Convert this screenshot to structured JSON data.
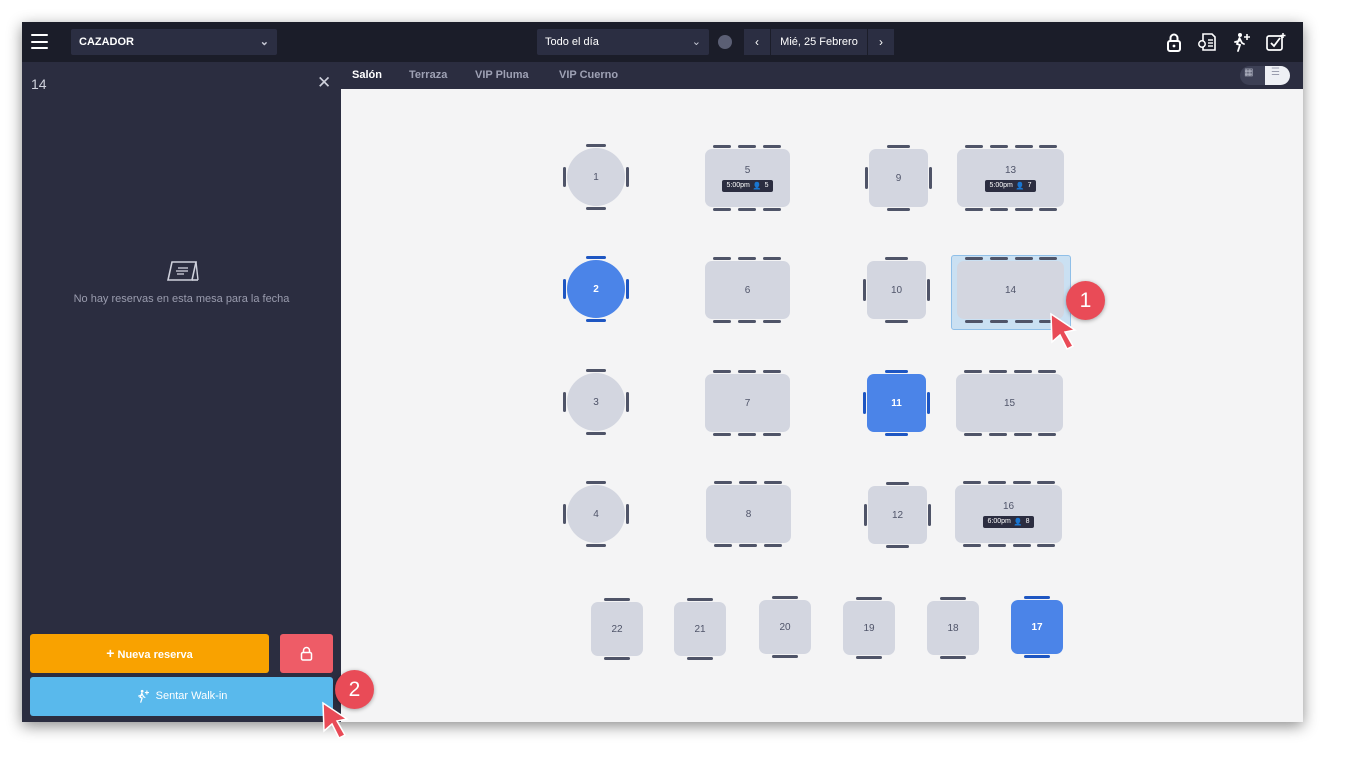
{
  "header": {
    "venue": "CAZADOR",
    "shift": "Todo el día",
    "date": "Mié, 25 Febrero",
    "icons": [
      "menu-icon",
      "lock-icon",
      "list-search-icon",
      "walk-in-icon",
      "checklist-icon"
    ]
  },
  "panel": {
    "table_number": "14",
    "empty_message": "No hay reservas en esta mesa para la fecha",
    "new_reservation_label": "Nueva reserva",
    "walkin_label": "Sentar Walk-in"
  },
  "tabs": [
    {
      "label": "Salón",
      "active": true
    },
    {
      "label": "Terraza",
      "active": false
    },
    {
      "label": "VIP Pluma",
      "active": false
    },
    {
      "label": "VIP Cuerno",
      "active": false
    }
  ],
  "tables": {
    "t1": {
      "label": "1",
      "state": "free"
    },
    "t2": {
      "label": "2",
      "state": "occupied"
    },
    "t3": {
      "label": "3",
      "state": "free"
    },
    "t4": {
      "label": "4",
      "state": "free"
    },
    "t5": {
      "label": "5",
      "state": "reserved",
      "time": "5:00pm",
      "guests": "5"
    },
    "t6": {
      "label": "6",
      "state": "free"
    },
    "t7": {
      "label": "7",
      "state": "free"
    },
    "t8": {
      "label": "8",
      "state": "free"
    },
    "t9": {
      "label": "9",
      "state": "free"
    },
    "t10": {
      "label": "10",
      "state": "free"
    },
    "t11": {
      "label": "11",
      "state": "occupied"
    },
    "t12": {
      "label": "12",
      "state": "free"
    },
    "t13": {
      "label": "13",
      "state": "reserved",
      "time": "5:00pm",
      "guests": "7"
    },
    "t14": {
      "label": "14",
      "state": "selected"
    },
    "t15": {
      "label": "15",
      "state": "free"
    },
    "t16": {
      "label": "16",
      "state": "reserved",
      "time": "6:00pm",
      "guests": "8"
    },
    "t17": {
      "label": "17",
      "state": "occupied"
    },
    "t18": {
      "label": "18",
      "state": "free"
    },
    "t19": {
      "label": "19",
      "state": "free"
    },
    "t20": {
      "label": "20",
      "state": "free"
    },
    "t21": {
      "label": "21",
      "state": "free"
    },
    "t22": {
      "label": "22",
      "state": "free"
    }
  },
  "markers": {
    "first": "1",
    "second": "2"
  },
  "colors": {
    "topbar": "#1b1d29",
    "panel": "#2b2d40",
    "table": "#d3d6e0",
    "table_active": "#4b84e8",
    "new_reservation": "#f9a200",
    "lock": "#ee5c67",
    "walkin": "#59b9ec",
    "marker": "#e94b57"
  }
}
